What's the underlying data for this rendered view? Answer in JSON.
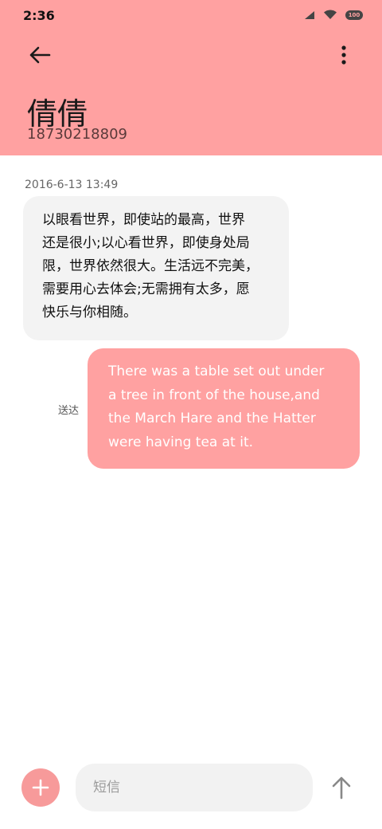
{
  "status_bar": {
    "time": "2:36",
    "battery": "100",
    "icons": [
      "signal-icon",
      "wifi-icon",
      "battery-icon"
    ]
  },
  "header": {
    "contact_name": "倩倩",
    "contact_number": "18730218809",
    "background_color": "#ffa1a1"
  },
  "messages": [
    {
      "direction": "incoming",
      "timestamp": "2016-6-13 13:49",
      "lines": [
        "以眼看世界，即使站的最高，世界",
        "还是很小;以心看世界，即使身处局",
        "限，世界依然很大。生活远不完美，",
        "需要用心去体会;无需拥有太多，愿",
        "快乐与你相随。"
      ]
    },
    {
      "direction": "outgoing",
      "status": "送达",
      "lines": [
        "There was a table set out under",
        "a tree in front of the house,and",
        "the March Hare and the Hatter",
        "were having tea at it."
      ]
    }
  ],
  "composer": {
    "placeholder": "短信",
    "value": "",
    "accent_color": "#f79a9a"
  }
}
